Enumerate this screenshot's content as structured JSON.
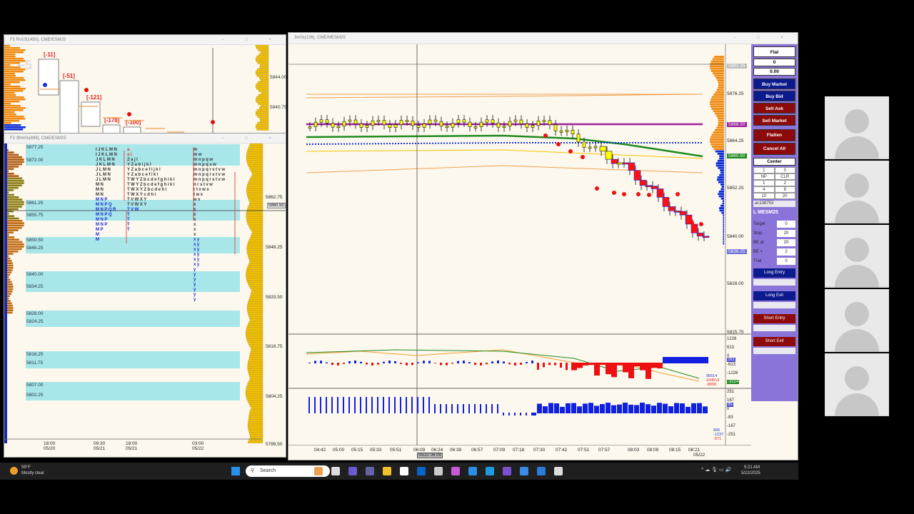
{
  "windows": {
    "f5": {
      "title": "F5 Rv10(1450), CME/ESM25",
      "watermark": "F5",
      "deltas": [
        "[-11]",
        "[-51]",
        "[-121]",
        "[-178]",
        "[-100]"
      ],
      "prices": [
        "5844.00",
        "5840.75"
      ]
    },
    "f2": {
      "title": "F2 30m0s(496), CME/ESM25",
      "watermark": "F2",
      "levels": [
        "5877.25",
        "5872.00",
        "5861.25",
        "5855.75",
        "5850.50",
        "5846.25",
        "5840.00",
        "5834.25",
        "5828.00",
        "5824.25",
        "5816.25",
        "5811.75",
        "5807.00",
        "5802.25"
      ],
      "axis": [
        "5862.75",
        "5848.25",
        "5833.50",
        "5818.75",
        "5804.25",
        "5789.50"
      ],
      "current": "5860.50",
      "times": [
        {
          "t": "18:00",
          "d": "05/20"
        },
        {
          "t": "09:30",
          "d": "05/21"
        },
        {
          "t": "18:00",
          "d": "05/21"
        },
        {
          "t": "03:00",
          "d": "05/22"
        }
      ],
      "tpo_col1": [
        "IJKLMN",
        "IJKLMN",
        "JKLMN",
        "JKLMN",
        "JLMN",
        "JLMN",
        "JLMN",
        "MN",
        "MN",
        "MN",
        "MNP",
        "MNPQ",
        "MNPQR",
        "MNPQ",
        "MNP",
        "MNP",
        "MP",
        "M",
        "M"
      ],
      "tpo_col2": [
        "a",
        "al",
        "Zajl",
        "YZabijkl",
        "YZabcefijkl",
        "YZabcefikl",
        "TWYZbcdefghikl",
        "TWYZbcdefghikl",
        "TWXYZbcdehi",
        "TWXYcdhi",
        "TVWXY",
        "TVWXY",
        "TVW",
        "T",
        "T",
        "T",
        "T"
      ],
      "tpo_col3": [
        "m",
        "mw",
        "mnpqw",
        "mnpqsw",
        "mnpqrstvw",
        "mnpqrstvw",
        "mnpqrstvw",
        "nrstvw",
        "rtvwx",
        "twx",
        "wx",
        "x",
        "x",
        "x",
        "x",
        "x",
        "x",
        "x",
        "xy",
        "xy",
        "xy",
        "xy",
        "xy",
        "xy",
        "y",
        "y",
        "y",
        "y",
        "y",
        "y",
        "y"
      ]
    },
    "main": {
      "title": "3m0s(136), CME/MESM25",
      "price_axis": [
        "5876.25",
        "5864.25",
        "5852.25",
        "5840.00",
        "5828.00",
        "5815.75"
      ],
      "tags": [
        {
          "v": "5883.25",
          "c": "#bbbbbb"
        },
        {
          "v": "5868.50",
          "c": "#9b1f9b"
        },
        {
          "v": "5860.50",
          "c": "#1f8a1f"
        },
        {
          "v": "5836.25",
          "c": "#6e6edc"
        }
      ],
      "ind1_axis": [
        "1226",
        "613",
        "0",
        "-613",
        "-1226"
      ],
      "ind1_tags": [
        "261",
        "-3224"
      ],
      "ind1_values": [
        "95514",
        "104513",
        "-8999"
      ],
      "ind2_axis": [
        "251",
        "167",
        "0",
        "-83",
        "-167",
        "-251"
      ],
      "ind2_tags": [
        "95"
      ],
      "ind2_values": [
        "666",
        "-1237",
        "-571"
      ],
      "times": [
        "04:42",
        "05:00",
        "05:15",
        "05:33",
        "05:51",
        "06:09",
        "06:24",
        "06:39",
        "06:57",
        "07:09",
        "07:18",
        "07:30",
        "07:42",
        "07:51",
        "07:57",
        "08:03",
        "08:09",
        "08:15",
        "08:21"
      ],
      "last_date": "05/22",
      "cursor_time": "05/22 06:09"
    }
  },
  "order_panel": {
    "position": "Flat",
    "qty": "0",
    "pnl": "0.00",
    "buttons": {
      "buy_market": "Buy Market",
      "buy_bid": "Buy Bid",
      "sell_ask": "Sell Ask",
      "sell_market": "Sell Market",
      "flatten": "Flatten",
      "cancel_all": "Cancel All",
      "center": "Center"
    },
    "qty_input": "1",
    "qty_right": "0",
    "grid": [
      "NP",
      "CLR",
      "1",
      "2",
      "4",
      "8",
      "10",
      "20"
    ],
    "account": "ac138753",
    "symbol": "L MESM25",
    "fields": [
      {
        "label": "Target",
        "value": "0"
      },
      {
        "label": "Stop",
        "value": "20"
      },
      {
        "label": "BE at",
        "value": "20"
      },
      {
        "label": "BE +",
        "value": "2"
      },
      {
        "label": "Trail",
        "value": "0"
      }
    ],
    "strategies": [
      "Long Entry",
      "Long Exit",
      "Short Entry",
      "Short Exit"
    ]
  },
  "taskbar": {
    "weather_temp": "59°F",
    "weather_desc": "Mostly clear",
    "search": "Search",
    "time": "5:21 AM",
    "date": "5/22/2025"
  },
  "colors": {
    "panel": "#8b74d9",
    "buy": "#0b1a8c",
    "sell": "#8c0a0a",
    "band": "#a8e6ea",
    "volume": "#f5c400"
  }
}
